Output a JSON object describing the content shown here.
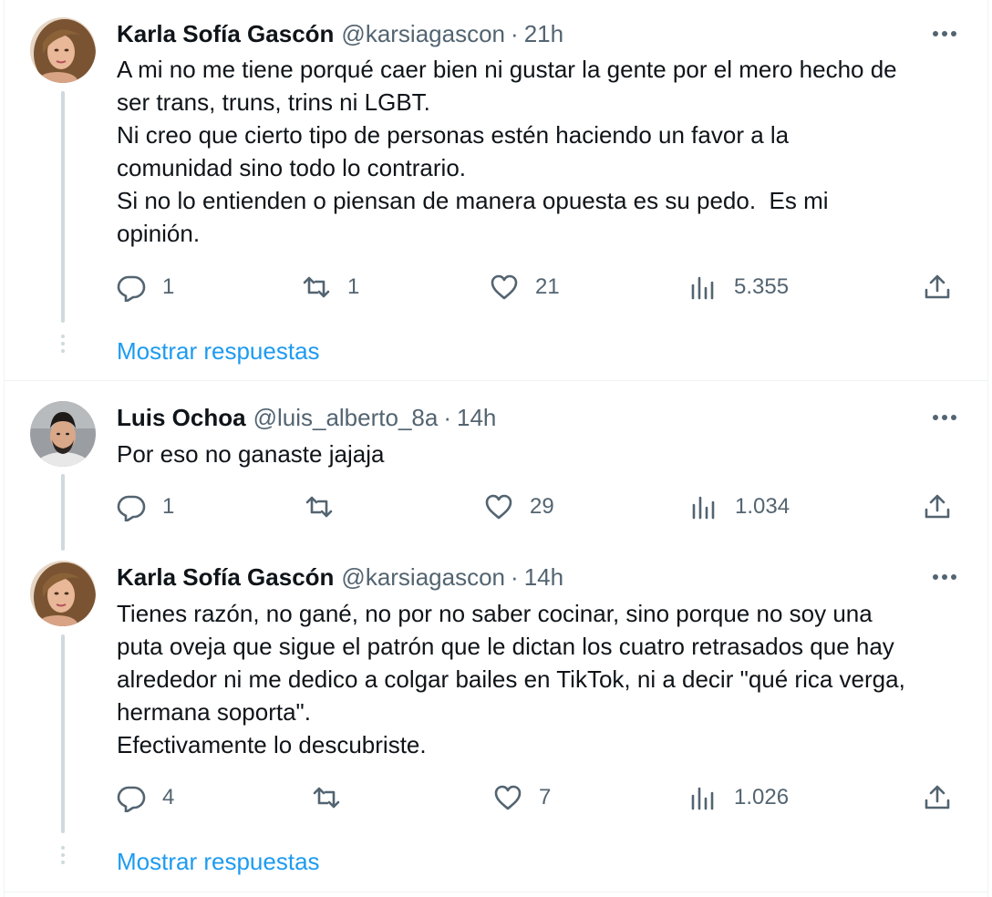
{
  "tweets": [
    {
      "name": "Karla Sofía Gascón",
      "handle": "@karsiagascon",
      "separator": "·",
      "time": "21h",
      "text_lines": [
        "A mi no me tiene porqué caer bien ni gustar la gente por el mero hecho de",
        "ser trans, truns, trins ni LGBT.",
        "Ni creo que cierto tipo de personas estén haciendo un favor a la",
        "comunidad sino todo lo contrario.",
        "Si no lo entienden o piensan de manera opuesta es su pedo.  Es mi",
        "opinión."
      ],
      "replies": "1",
      "retweets": "1",
      "likes": "21",
      "views": "5.355",
      "show_replies_label": "Mostrar respuestas"
    },
    {
      "name": "Luis Ochoa",
      "handle": "@luis_alberto_8a",
      "separator": "·",
      "time": "14h",
      "text_lines": [
        "Por eso no ganaste jajaja"
      ],
      "replies": "1",
      "retweets": "",
      "likes": "29",
      "views": "1.034"
    },
    {
      "name": "Karla Sofía Gascón",
      "handle": "@karsiagascon",
      "separator": "·",
      "time": "14h",
      "text_lines": [
        "Tienes razón, no gané, no por no saber cocinar, sino porque no soy una",
        "puta oveja que sigue el patrón que le dictan los cuatro retrasados que hay",
        "alrededor ni me dedico a colgar bailes en TikTok, ni a decir \"qué rica verga,",
        "hermana soporta\".",
        "Efectivamente lo descubriste."
      ],
      "replies": "4",
      "retweets": "",
      "likes": "7",
      "views": "1.026",
      "show_replies_label": "Mostrar respuestas"
    }
  ],
  "colors": {
    "text": "#0f1419",
    "secondary": "#536471",
    "link": "#1d9bf0",
    "thread_line": "#cfd9de",
    "divider": "#eff3f4"
  },
  "icons": {
    "reply": "reply-icon",
    "retweet": "retweet-icon",
    "like": "heart-icon",
    "views": "views-icon",
    "share": "share-icon",
    "more": "more-icon"
  }
}
